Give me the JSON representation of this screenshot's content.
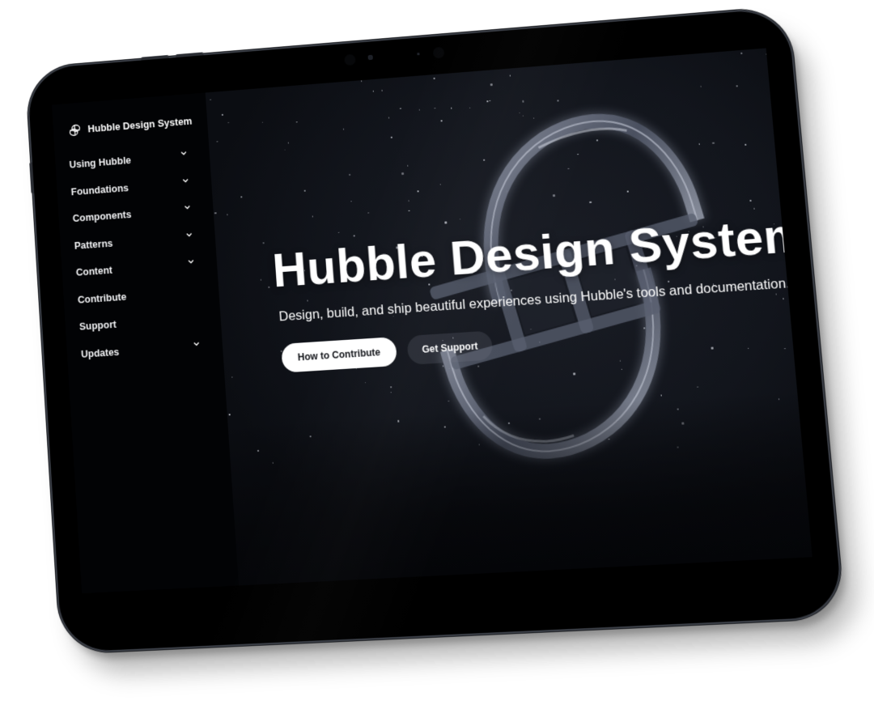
{
  "device": {
    "type": "tablet",
    "frame_color": "#000000"
  },
  "sidebar": {
    "brand": {
      "icon": "hubble-logo-icon",
      "label": "Hubble Design System"
    },
    "items": [
      {
        "label": "Using Hubble",
        "has_submenu": true,
        "icon": "chevron-down-icon"
      },
      {
        "label": "Foundations",
        "has_submenu": true,
        "icon": "chevron-down-icon"
      },
      {
        "label": "Components",
        "has_submenu": true,
        "icon": "chevron-down-icon"
      },
      {
        "label": "Patterns",
        "has_submenu": true,
        "icon": "chevron-down-icon"
      },
      {
        "label": "Content",
        "has_submenu": true,
        "icon": "chevron-down-icon"
      },
      {
        "label": "Contribute",
        "has_submenu": false
      },
      {
        "label": "Support",
        "has_submenu": false
      },
      {
        "label": "Updates",
        "has_submenu": true,
        "icon": "chevron-down-icon"
      }
    ]
  },
  "hero": {
    "title": "Hubble Design System",
    "subtitle": "Design, build, and ship beautiful experiences using Hubble's tools and documentation.",
    "primary_button": {
      "label": "How to Contribute"
    },
    "secondary_button": {
      "label": "Get Support"
    },
    "background_art": "glass-hubble-logo-in-starfield"
  },
  "colors": {
    "sidebar_bg": "#020305",
    "hero_bg": "#12151c",
    "text": "#ffffff",
    "primary_button_bg": "#ffffff",
    "primary_button_text": "#111318"
  }
}
